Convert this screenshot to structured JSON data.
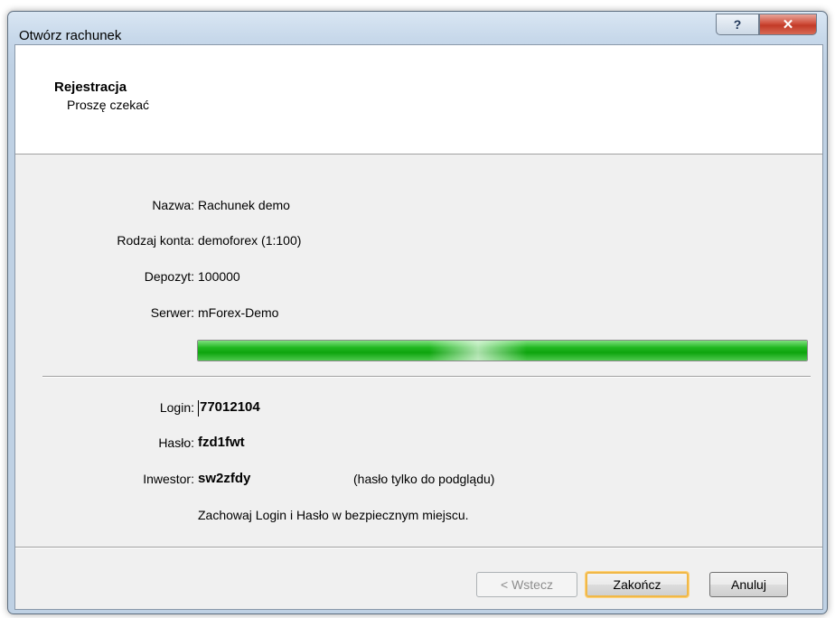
{
  "window": {
    "title": "Otwórz rachunek",
    "help_icon": "?",
    "close_icon": "✕"
  },
  "header": {
    "title": "Rejestracja",
    "subtitle": "Proszę czekać"
  },
  "account": {
    "name_label": "Nazwa:",
    "name_value": "Rachunek demo",
    "type_label": "Rodzaj konta:",
    "type_value": "demoforex (1:100)",
    "deposit_label": "Depozyt:",
    "deposit_value": "100000",
    "server_label": "Serwer:",
    "server_value": "mForex-Demo"
  },
  "progress": {
    "percent": 100,
    "color": "#1fb41f"
  },
  "credentials": {
    "login_label": "Login:",
    "login_value": "77012104",
    "password_label": "Hasło:",
    "password_value": "fzd1fwt",
    "investor_label": "Inwestor:",
    "investor_value": "sw2zfdy",
    "investor_note": "(hasło tylko do podglądu)",
    "notice": "Zachowaj Login i Hasło w bezpiecznym miejscu."
  },
  "buttons": {
    "back": "< Wstecz",
    "finish": "Zakończ",
    "cancel": "Anuluj"
  },
  "colors": {
    "default_button_highlight": "#f0b848",
    "close_button": "#c23a27"
  }
}
